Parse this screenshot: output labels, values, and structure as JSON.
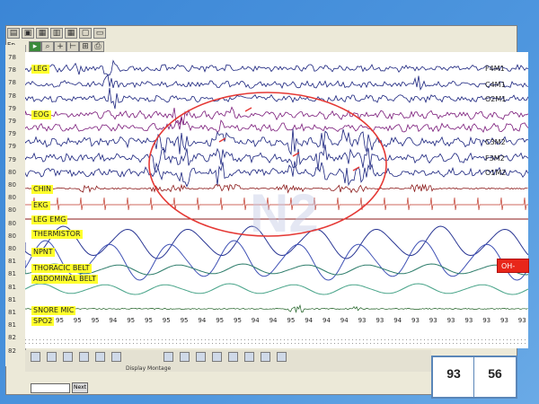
{
  "toolbar": {
    "epoch_header": "Ep"
  },
  "epochs": [
    "78",
    "78",
    "78",
    "78",
    "79",
    "79",
    "79",
    "79",
    "79",
    "80",
    "80",
    "80",
    "80",
    "80",
    "80",
    "80",
    "81",
    "81",
    "81",
    "81",
    "81",
    "81",
    "82",
    "82"
  ],
  "channels": [
    {
      "label": "LEG",
      "right": "F4M1",
      "color": "#1a237e"
    },
    {
      "label": "",
      "right": "C4M1",
      "color": "#1a237e"
    },
    {
      "label": "",
      "right": "O2M1",
      "color": "#1a237e"
    },
    {
      "label": "EOG",
      "right": "",
      "color": "#7a1a7a"
    },
    {
      "label": "",
      "right": "",
      "color": "#7a1a7a"
    },
    {
      "label": "",
      "right": "C3M2",
      "color": "#1a237e"
    },
    {
      "label": "",
      "right": "F3M2",
      "color": "#1a237e"
    },
    {
      "label": "",
      "right": "O1M2",
      "color": "#1a237e"
    },
    {
      "label": "CHIN",
      "right": "",
      "color": "#8b1a1a"
    },
    {
      "label": "EKG",
      "right": "",
      "color": "#c0392b"
    },
    {
      "label": "LEG EMG",
      "right": "",
      "color": "#8b1a1a"
    },
    {
      "label": "THERMISTOR",
      "right": "",
      "color": "#283593"
    },
    {
      "label": "NPNT",
      "right": "",
      "color": "#3f51b5"
    },
    {
      "label": "THORACIC BELT",
      "right": "",
      "color": "#2e7d6b"
    },
    {
      "label": "ABDOMINAL BELT",
      "right": "",
      "color": "#2e7d6b"
    },
    {
      "label": "SNORE MIC",
      "right": "",
      "color": "#1b5e20"
    },
    {
      "label": "SPO2",
      "right": "",
      "color": "#333333"
    }
  ],
  "spo2_values": [
    "95",
    "95",
    "95",
    "94",
    "95",
    "95",
    "95",
    "95",
    "94",
    "95",
    "95",
    "94",
    "94",
    "95",
    "94",
    "94",
    "94",
    "93",
    "93",
    "94",
    "93",
    "93",
    "93",
    "93",
    "93",
    "93",
    "93"
  ],
  "watermark": "N2",
  "alert_badge": "OH-",
  "bottom": {
    "display_montage": "Display Montage",
    "go_button": "Next"
  },
  "readouts": {
    "left": "93",
    "right": "56"
  },
  "colors": {
    "frame_blue": "#3b86d6",
    "eeg": "#1a237e",
    "eog": "#7a1a7a",
    "chin": "#8b1a1a",
    "ekg": "#c0392b",
    "annotation_circle": "#e53935",
    "label_bg": "#ffff2d"
  }
}
